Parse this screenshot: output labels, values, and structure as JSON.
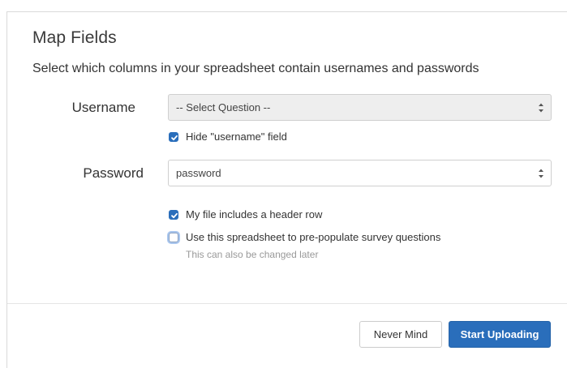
{
  "dialog": {
    "title": "Map Fields",
    "subtitle": "Select which columns in your spreadsheet contain usernames and passwords"
  },
  "username": {
    "label": "Username",
    "selected": "-- Select Question --",
    "disabled": true,
    "hide_checkbox": {
      "label": "Hide \"username\" field",
      "checked": true
    }
  },
  "password": {
    "label": "Password",
    "selected": "password"
  },
  "options": {
    "header_row": {
      "label": "My file includes a header row",
      "checked": true
    },
    "prepopulate": {
      "label": "Use this spreadsheet to pre-populate survey questions",
      "checked": false,
      "hint": "This can also be changed later"
    }
  },
  "footer": {
    "cancel_label": "Never Mind",
    "submit_label": "Start Uploading"
  },
  "colors": {
    "primary": "#2a6ebb",
    "disabled_bg": "#eeeeee",
    "hint_text": "#999999"
  }
}
